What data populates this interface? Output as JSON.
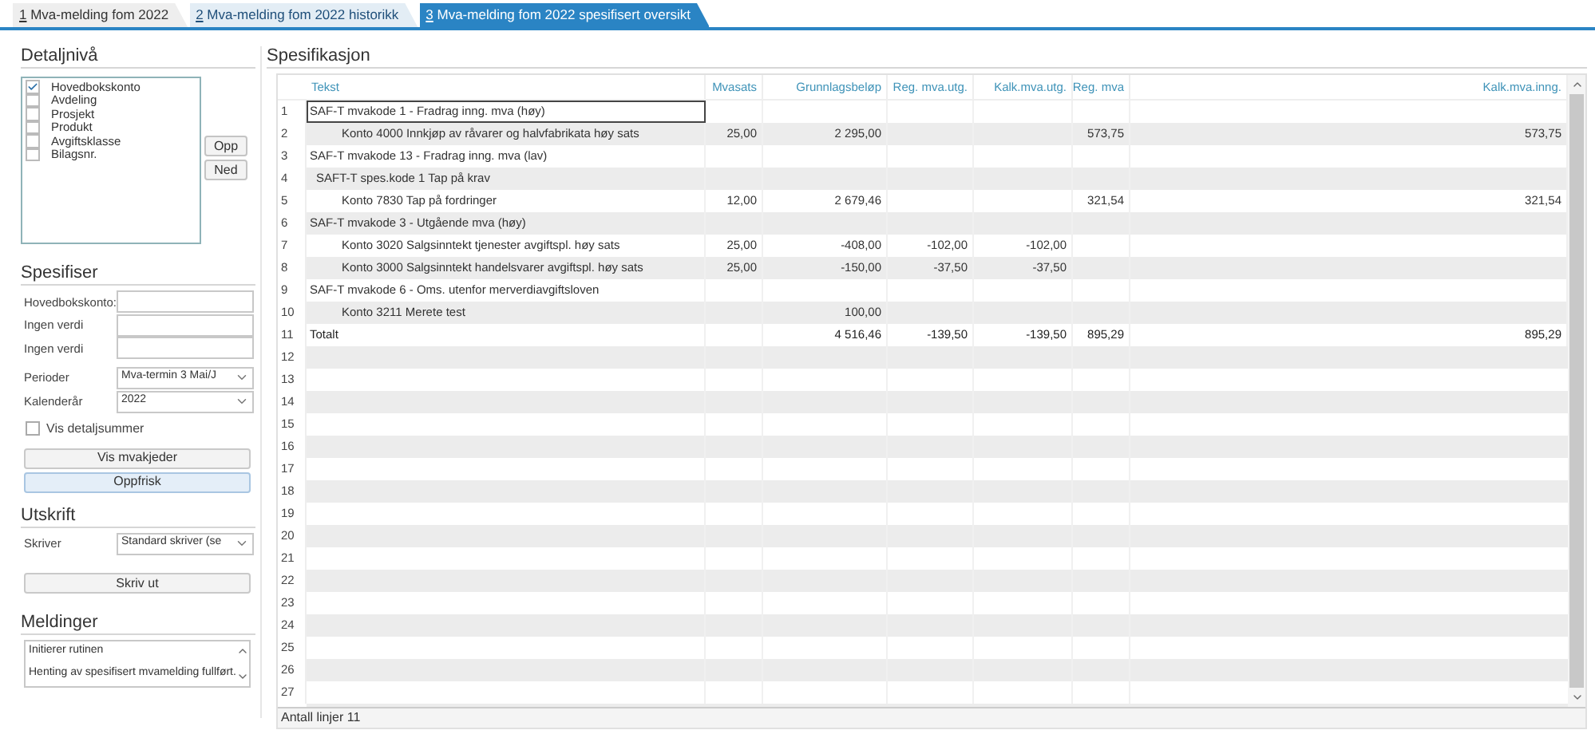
{
  "tabs": [
    {
      "key": "1",
      "label": " Mva-melding fom 2022",
      "selected": false
    },
    {
      "key": "2",
      "label": " Mva-melding fom 2022 historikk",
      "selected": false
    },
    {
      "key": "3",
      "label": " Mva-melding fom 2022 spesifisert oversikt",
      "selected": true
    }
  ],
  "detail": {
    "title": "Detaljnivå",
    "items": [
      {
        "label": "Hovedbokskonto",
        "checked": true
      },
      {
        "label": "Avdeling",
        "checked": false
      },
      {
        "label": "Prosjekt",
        "checked": false
      },
      {
        "label": "Produkt",
        "checked": false
      },
      {
        "label": "Avgiftsklasse",
        "checked": false
      },
      {
        "label": "Bilagsnr.",
        "checked": false
      }
    ],
    "buttons": [
      "Opp",
      "Ned"
    ]
  },
  "specify": {
    "title": "Spesifiser",
    "fields": [
      {
        "label": "Hovedbokskonto:"
      },
      {
        "label": "Ingen verdi"
      },
      {
        "label": "Ingen verdi"
      }
    ],
    "selects": [
      {
        "label": "Perioder",
        "value": "Mva-termin 3 Mai/J"
      },
      {
        "label": "Kalenderår",
        "value": "2022"
      }
    ],
    "checkbox": {
      "label": "Vis detaljsummer",
      "checked": false
    },
    "buttons": [
      {
        "label": "Vis mvakjeder",
        "default": false
      },
      {
        "label": "Oppfrisk",
        "default": true
      }
    ]
  },
  "print": {
    "title": "Utskrift",
    "select": {
      "label": "Skriver",
      "value": "Standard skriver (se"
    },
    "button": "Skriv ut"
  },
  "messages": {
    "title": "Meldinger",
    "lines": [
      "Initierer rutinen",
      "Henting av spesifisert mvamelding fullført."
    ]
  },
  "spec": {
    "title": "Spesifikasjon",
    "columns": [
      "Tekst",
      "Mvasats",
      "Grunnlagsbeløp",
      "Reg. mva.utg.",
      "Kalk.mva.utg.",
      "Reg. mva",
      "Kalk.mva.inng."
    ],
    "rows": [
      {
        "number": "1",
        "kind": "code",
        "selected": true,
        "cells": [
          "SAF-T mvakode 1 - Fradrag inng. mva (høy)",
          "",
          "",
          "",
          "",
          "",
          ""
        ]
      },
      {
        "number": "2",
        "kind": "account",
        "selected": false,
        "cells": [
          "Konto 4000 Innkjøp av råvarer og halvfabrikata høy sats",
          "25,00",
          "2 295,00",
          "",
          "",
          "573,75",
          "573,75"
        ]
      },
      {
        "number": "3",
        "kind": "code",
        "selected": false,
        "cells": [
          "SAF-T mvakode 13 - Fradrag inng. mva (lav)",
          "",
          "",
          "",
          "",
          "",
          ""
        ]
      },
      {
        "number": "4",
        "kind": "spec",
        "selected": false,
        "cells": [
          "SAFT-T spes.kode 1 Tap på krav",
          "",
          "",
          "",
          "",
          "",
          ""
        ]
      },
      {
        "number": "5",
        "kind": "account",
        "selected": false,
        "cells": [
          "Konto 7830 Tap på fordringer",
          "12,00",
          "2 679,46",
          "",
          "",
          "321,54",
          "321,54"
        ]
      },
      {
        "number": "6",
        "kind": "code",
        "selected": false,
        "cells": [
          "SAF-T mvakode 3 - Utgående mva (høy)",
          "",
          "",
          "",
          "",
          "",
          ""
        ]
      },
      {
        "number": "7",
        "kind": "account",
        "selected": false,
        "cells": [
          "Konto 3020 Salgsinntekt tjenester avgiftspl. høy sats",
          "25,00",
          "-408,00",
          "-102,00",
          "-102,00",
          "",
          ""
        ]
      },
      {
        "number": "8",
        "kind": "account",
        "selected": false,
        "cells": [
          "Konto 3000 Salgsinntekt handelsvarer avgiftspl. høy sats",
          "25,00",
          "-150,00",
          "-37,50",
          "-37,50",
          "",
          ""
        ]
      },
      {
        "number": "9",
        "kind": "code",
        "selected": false,
        "cells": [
          "SAF-T mvakode 6 - Oms. utenfor merverdiavgiftsloven",
          "",
          "",
          "",
          "",
          "",
          ""
        ]
      },
      {
        "number": "10",
        "kind": "account",
        "selected": false,
        "cells": [
          "Konto 3211 Merete test",
          "",
          "100,00",
          "",
          "",
          "",
          ""
        ]
      },
      {
        "number": "11",
        "kind": "total",
        "selected": false,
        "cells": [
          "Totalt",
          "",
          "4 516,46",
          "-139,50",
          "-139,50",
          "895,29",
          "895,29"
        ]
      }
    ],
    "empty_rows": [
      "12",
      "13",
      "14",
      "15",
      "16",
      "17",
      "18",
      "19",
      "20",
      "21",
      "22",
      "23",
      "24",
      "25",
      "26",
      "27"
    ],
    "footer": "Antall linjer 11"
  }
}
